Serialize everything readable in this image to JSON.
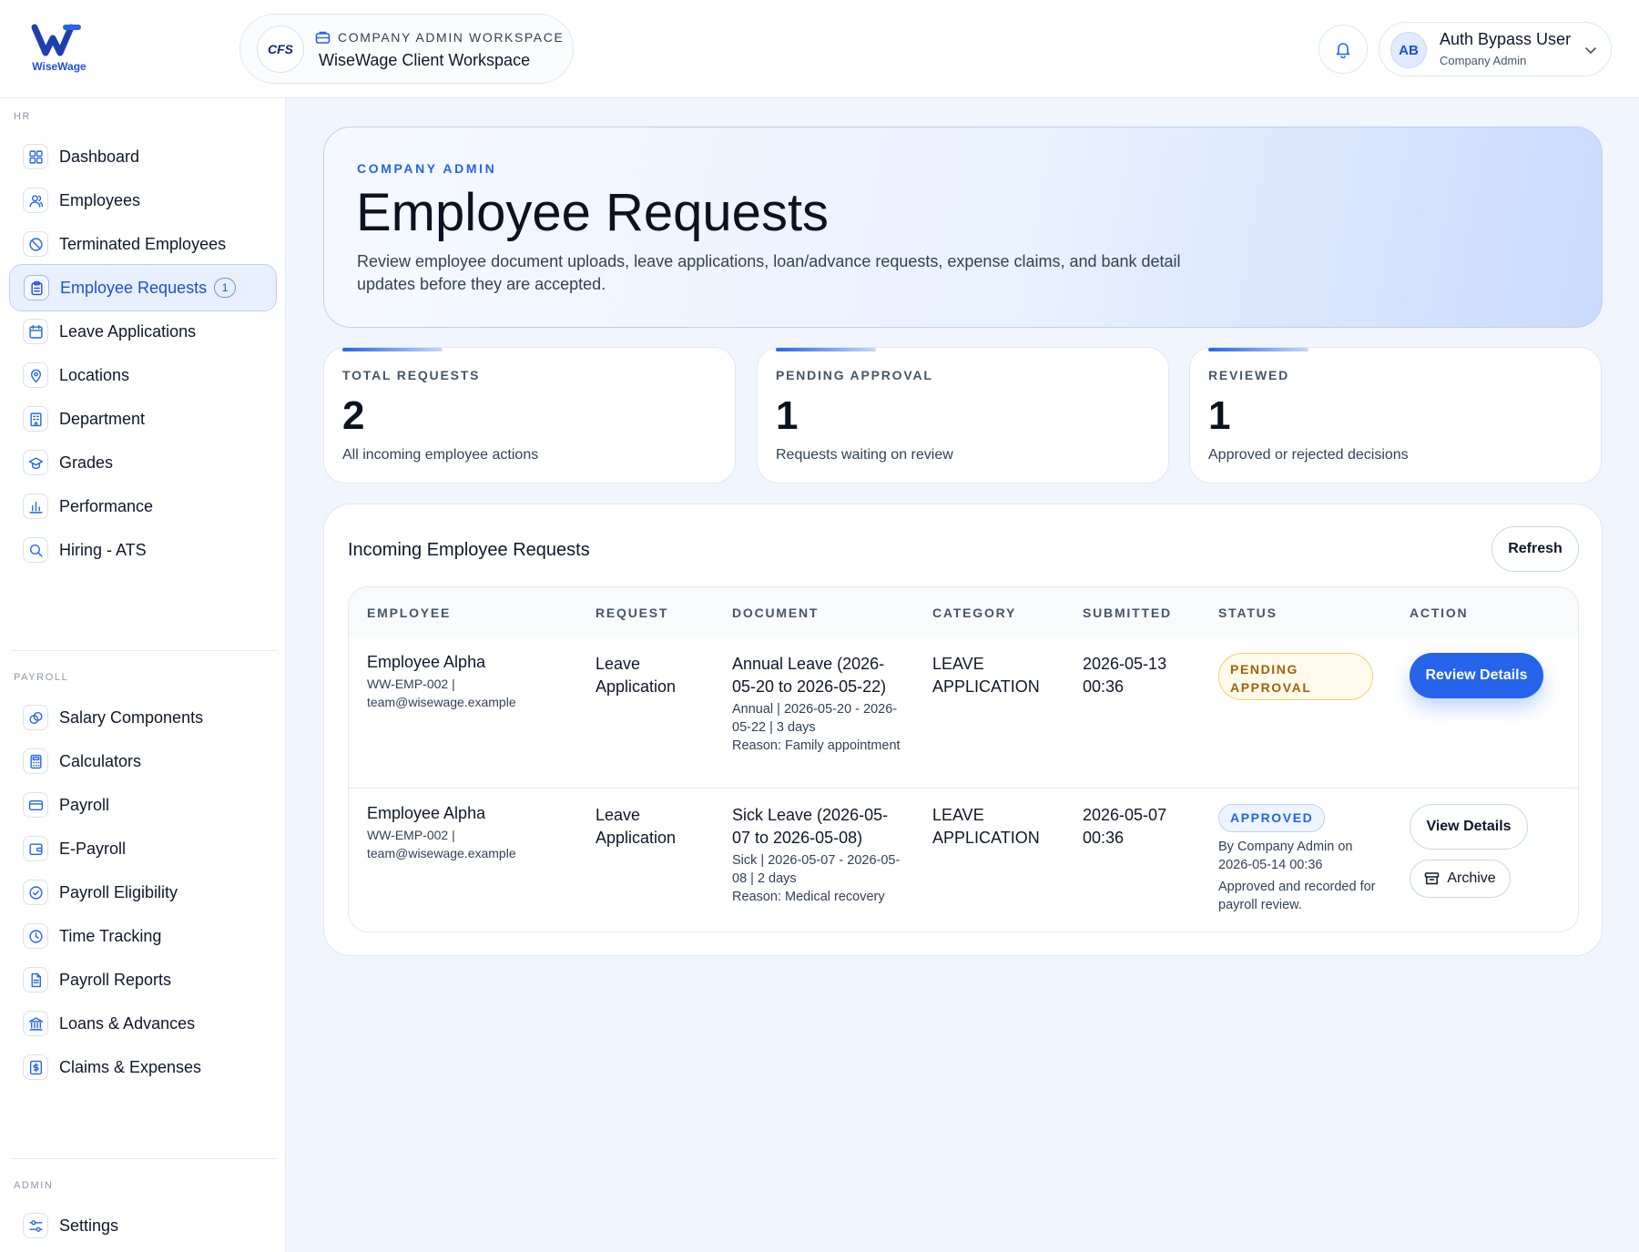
{
  "brand": {
    "logo_text": "WiseWage"
  },
  "workspace": {
    "eyebrow": "COMPANY ADMIN WORKSPACE",
    "name": "WiseWage Client Workspace",
    "client_logo": "CFS"
  },
  "user": {
    "initials": "AB",
    "name": "Auth Bypass User",
    "role": "Company Admin"
  },
  "sidebar": {
    "hr_label": "HR",
    "hr_items": [
      {
        "label": "Dashboard",
        "icon": "grid-icon"
      },
      {
        "label": "Employees",
        "icon": "users-icon"
      },
      {
        "label": "Terminated Employees",
        "icon": "ban-icon"
      },
      {
        "label": "Employee Requests",
        "icon": "clipboard-icon",
        "badge": "1",
        "active": true
      },
      {
        "label": "Leave Applications",
        "icon": "calendar-icon"
      },
      {
        "label": "Locations",
        "icon": "map-pin-icon"
      },
      {
        "label": "Department",
        "icon": "building-icon"
      },
      {
        "label": "Grades",
        "icon": "graduation-cap-icon"
      },
      {
        "label": "Performance",
        "icon": "bar-chart-icon"
      },
      {
        "label": "Hiring - ATS",
        "icon": "search-icon"
      }
    ],
    "payroll_label": "PAYROLL",
    "payroll_items": [
      {
        "label": "Salary Components",
        "icon": "coins-icon"
      },
      {
        "label": "Calculators",
        "icon": "calculator-icon"
      },
      {
        "label": "Payroll",
        "icon": "credit-card-icon"
      },
      {
        "label": "E-Payroll",
        "icon": "wallet-icon"
      },
      {
        "label": "Payroll Eligibility",
        "icon": "check-circle-icon"
      },
      {
        "label": "Time Tracking",
        "icon": "clock-icon"
      },
      {
        "label": "Payroll Reports",
        "icon": "file-text-icon"
      },
      {
        "label": "Loans & Advances",
        "icon": "bank-icon"
      },
      {
        "label": "Claims & Expenses",
        "icon": "receipt-icon"
      }
    ],
    "admin_label": "ADMIN",
    "admin_items": [
      {
        "label": "Settings",
        "icon": "sliders-icon"
      }
    ]
  },
  "hero": {
    "eyebrow": "COMPANY ADMIN",
    "title": "Employee Requests",
    "description": "Review employee document uploads, leave applications, loan/advance requests, expense claims, and bank detail updates before they are accepted."
  },
  "stats": [
    {
      "label": "TOTAL REQUESTS",
      "value": "2",
      "sub": "All incoming employee actions"
    },
    {
      "label": "PENDING APPROVAL",
      "value": "1",
      "sub": "Requests waiting on review"
    },
    {
      "label": "REVIEWED",
      "value": "1",
      "sub": "Approved or rejected decisions"
    }
  ],
  "requests": {
    "title": "Incoming Employee Requests",
    "refresh_label": "Refresh",
    "columns": [
      "EMPLOYEE",
      "REQUEST",
      "DOCUMENT",
      "CATEGORY",
      "SUBMITTED",
      "STATUS",
      "ACTION"
    ],
    "rows": [
      {
        "employee": "Employee Alpha",
        "emp_id": "WW-EMP-002 |",
        "emp_email": "team@wisewage.example",
        "request": "Leave Application",
        "doc_title": "Annual Leave (2026-05-20 to 2026-05-22)",
        "doc_detail": "Annual | 2026-05-20 - 2026-05-22 | 3 days",
        "doc_reason": "Reason: Family appointment",
        "category": "LEAVE APPLICATION",
        "submitted": "2026-05-13 00:36",
        "status": "PENDING APPROVAL",
        "action": "Review Details"
      },
      {
        "employee": "Employee Alpha",
        "emp_id": "WW-EMP-002 |",
        "emp_email": "team@wisewage.example",
        "request": "Leave Application",
        "doc_title": "Sick Leave (2026-05-07 to 2026-05-08)",
        "doc_detail": "Sick | 2026-05-07 - 2026-05-08 | 2 days",
        "doc_reason": "Reason: Medical recovery",
        "category": "LEAVE APPLICATION",
        "submitted": "2026-05-07 00:36",
        "status": "APPROVED",
        "status_by": "By Company Admin on 2026-05-14 00:36",
        "status_note": "Approved and recorded for payroll review.",
        "action": "View Details",
        "action2": "Archive"
      }
    ]
  },
  "colors": {
    "accent": "#2563eb",
    "pending_border": "#f3cf6b",
    "pending_text": "#a16207",
    "approved_text": "#2563eb"
  }
}
